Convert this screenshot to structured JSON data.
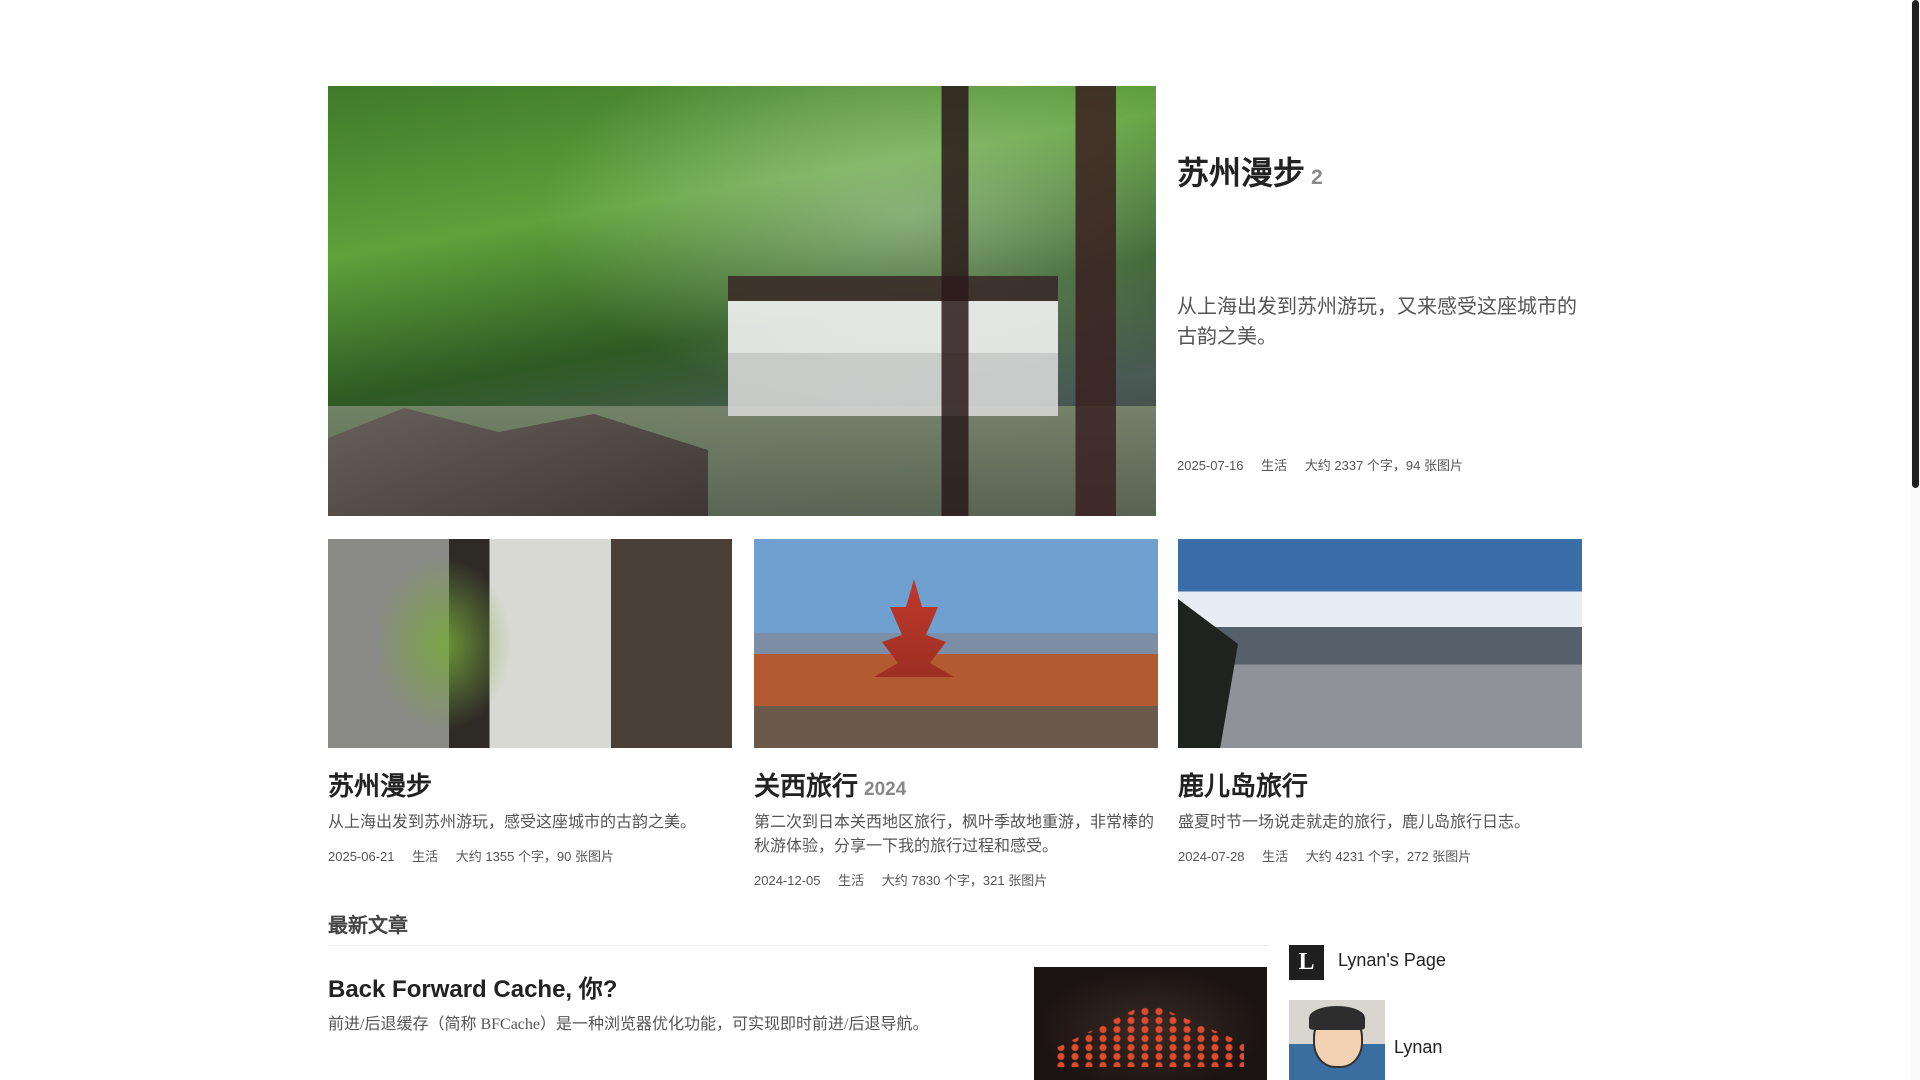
{
  "featured": {
    "title": "苏州漫步",
    "badge": "2",
    "description": "从上海出发到苏州游玩，又来感受这座城市的古韵之美。",
    "date": "2025-07-16",
    "category": "生活",
    "stats": "大约 2337 个字，94 张图片"
  },
  "cards": [
    {
      "title": "苏州漫步",
      "badge": "",
      "description": "从上海出发到苏州游玩，感受这座城市的古韵之美。",
      "date": "2025-06-21",
      "category": "生活",
      "stats": "大约 1355 个字，90 张图片"
    },
    {
      "title": "关西旅行",
      "badge": "2024",
      "description": "第二次到日本关西地区旅行，枫叶季故地重游，非常棒的秋游体验，分享一下我的旅行过程和感受。",
      "date": "2024-12-05",
      "category": "生活",
      "stats": "大约 7830 个字，321 张图片"
    },
    {
      "title": "鹿儿岛旅行",
      "badge": "",
      "description": "盛夏时节一场说走就走的旅行，鹿儿岛旅行日志。",
      "date": "2024-07-28",
      "category": "生活",
      "stats": "大约 4231 个字，272 张图片"
    }
  ],
  "recent": {
    "section_title": "最新文章",
    "posts": [
      {
        "title": "Back Forward Cache, 你?",
        "description": "前进/后退缓存（简称 BFCache）是一种浏览器优化功能，可实现即时前进/后退导航。"
      }
    ]
  },
  "sidebar": {
    "logo_letter": "L",
    "site_name": "Lynan's Page",
    "author_name": "Lynan"
  }
}
